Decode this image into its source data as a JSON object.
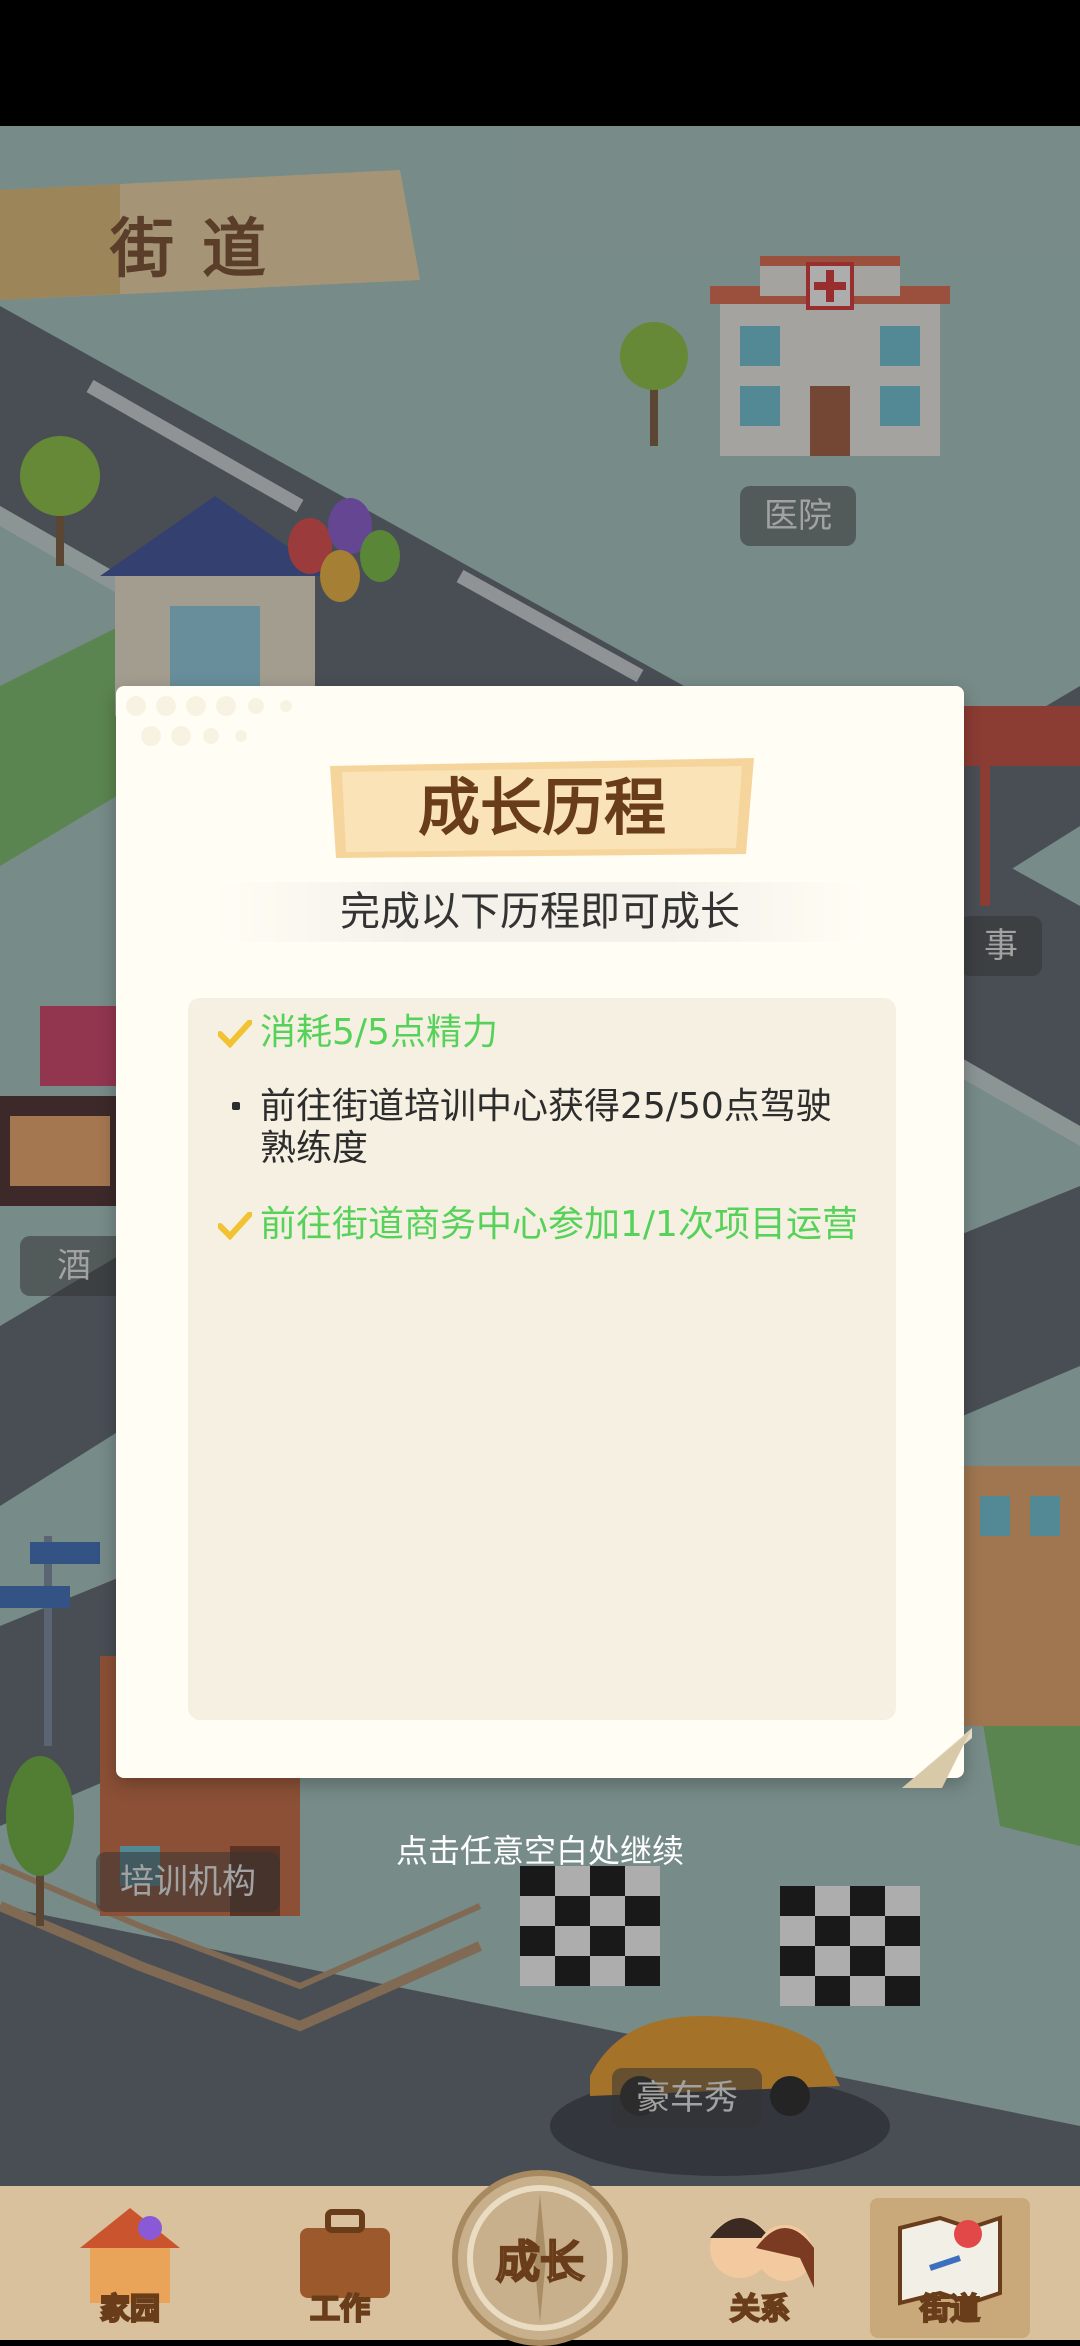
{
  "scene": {
    "street_title": "街道",
    "places": [
      {
        "id": "hospital",
        "label": "医院"
      },
      {
        "id": "bar",
        "label": "酒"
      },
      {
        "id": "event",
        "label": "事"
      },
      {
        "id": "training",
        "label": "培训机构"
      },
      {
        "id": "car_show",
        "label": "豪车秀"
      }
    ]
  },
  "dialog": {
    "title": "成长历程",
    "subtitle": "完成以下历程即可成长",
    "tasks": [
      {
        "text": "消耗5/5点精力",
        "status": "done"
      },
      {
        "text": "前往街道培训中心获得25/50点驾驶熟练度",
        "status": "todo"
      },
      {
        "text": "前往街道商务中心参加1/1次项目运营",
        "status": "done"
      }
    ],
    "colors": {
      "done": "#56d25a",
      "todo": "#2d2d2d",
      "title": "#6a3d1a"
    }
  },
  "continue_hint": "点击任意空白处继续",
  "bottom_nav": {
    "items": [
      {
        "id": "home",
        "label": "家园",
        "icon": "house-icon"
      },
      {
        "id": "work",
        "label": "工作",
        "icon": "briefcase-icon"
      },
      {
        "id": "growth",
        "label": "成长",
        "icon": "compass-icon"
      },
      {
        "id": "relations",
        "label": "关系",
        "icon": "couple-icon"
      },
      {
        "id": "street",
        "label": "街道",
        "icon": "map-icon"
      }
    ],
    "active": "street"
  }
}
